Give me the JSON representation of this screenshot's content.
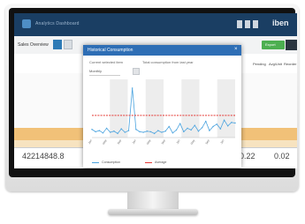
{
  "app": {
    "title": "Analytics Dashboard",
    "brand": "iben",
    "toolbar_label": "Sales Overview",
    "toolbar_button": "Export"
  },
  "table": {
    "headers_right": [
      "Pending",
      "Avg/Unit",
      "Reorder"
    ]
  },
  "footer": {
    "total_left": "42214848.8",
    "total_mid": "0.22",
    "total_right": "0.02"
  },
  "modal": {
    "title": "Historical Consumption",
    "label_left": "Current selected item",
    "label_right": "Total consumption from last year",
    "select_value": "Monthly"
  },
  "chart_data": {
    "type": "line",
    "categories": [
      "Jan",
      "Feb",
      "Mar",
      "Apr",
      "May",
      "Jun",
      "Jul",
      "Aug",
      "Sep",
      "Oct",
      "Nov",
      "Dec",
      "Jan",
      "Feb",
      "Mar",
      "Apr",
      "May",
      "Jun",
      "Jul",
      "Aug",
      "Sep",
      "Oct",
      "Nov",
      "Dec",
      "Jan",
      "Feb",
      "Mar",
      "Apr",
      "May",
      "Jun",
      "Jul",
      "Aug",
      "Sep",
      "Oct",
      "Nov",
      "Dec",
      "Jan",
      "Feb",
      "Mar",
      "Apr"
    ],
    "ylim": [
      0,
      100
    ],
    "series": [
      {
        "name": "Consumption",
        "color": "#4aa3df",
        "values": [
          14,
          10,
          12,
          8,
          16,
          9,
          11,
          7,
          15,
          9,
          12,
          85,
          14,
          10,
          9,
          11,
          10,
          7,
          12,
          9,
          11,
          19,
          8,
          13,
          24,
          10,
          16,
          13,
          21,
          11,
          17,
          28,
          12,
          19,
          23,
          15,
          30,
          20,
          26,
          25
        ]
      },
      {
        "name": "Average",
        "color": "#e53935",
        "values": [
          38,
          38,
          38,
          38,
          38,
          38,
          38,
          38,
          38,
          38,
          38,
          38,
          38,
          38,
          38,
          38,
          38,
          38,
          38,
          38,
          38,
          38,
          38,
          38,
          38,
          38,
          38,
          38,
          38,
          38,
          38,
          38,
          38,
          38,
          38,
          38,
          38,
          38,
          38,
          38
        ]
      }
    ],
    "grid": true,
    "legend_position": "bottom"
  }
}
